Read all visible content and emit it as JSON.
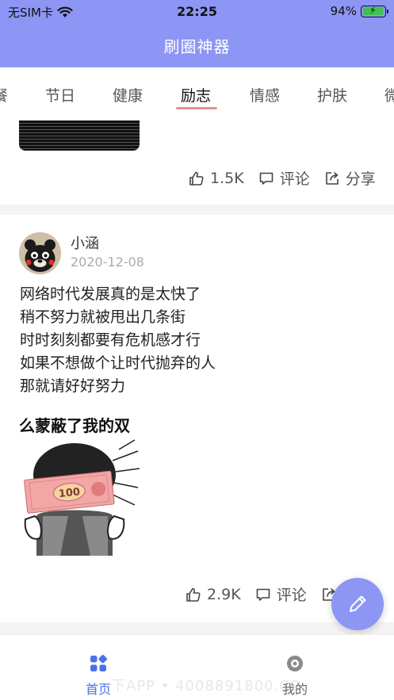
{
  "status_bar": {
    "carrier": "无SIM卡",
    "time": "22:25",
    "battery": "94%",
    "battery_level": 94
  },
  "header": {
    "title": "刷圈神器"
  },
  "tabs": {
    "items": [
      {
        "label": "餐"
      },
      {
        "label": "节日"
      },
      {
        "label": "健康"
      },
      {
        "label": "励志"
      },
      {
        "label": "情感"
      },
      {
        "label": "护肤"
      },
      {
        "label": "微"
      }
    ],
    "active": "励志"
  },
  "posts": [
    {
      "likes": "1.5K",
      "comment_label": "评论",
      "share_label": "分享"
    },
    {
      "author": "小涵",
      "date": "2020-12-08",
      "lines": [
        "网络时代发展真的是太快了",
        "稍不努力就被甩出几条街",
        "时时刻刻都要有危机感才行",
        "如果不想做个让时代抛弃的人",
        "那就请好好努力"
      ],
      "image_caption": "么蒙蔽了我的双",
      "banknote_value": "100",
      "likes": "2.9K",
      "comment_label": "评论"
    }
  ],
  "bottom_nav": {
    "items": [
      {
        "label": "首页",
        "active": true
      },
      {
        "label": "我的",
        "active": false
      }
    ],
    "watermark": "下APP • 4008891800.CO"
  },
  "colors": {
    "primary": "#8d96f4",
    "tab_underline": "#e98f95",
    "nav_active": "#4a72e8",
    "nav_inactive": "#666666"
  }
}
